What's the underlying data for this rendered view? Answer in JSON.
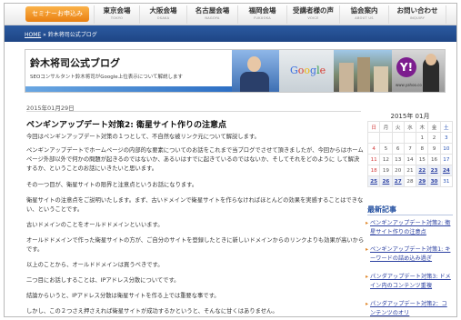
{
  "nav": {
    "seminar": "セミナーお申込み",
    "items": [
      {
        "label": "東京会場",
        "sub": "TOKYO"
      },
      {
        "label": "大阪会場",
        "sub": "OSAKA"
      },
      {
        "label": "名古屋会場",
        "sub": "NAGOYA"
      },
      {
        "label": "福岡会場",
        "sub": "FUKUOKA"
      },
      {
        "label": "受講者様の声",
        "sub": "VOICE"
      },
      {
        "label": "協会案内",
        "sub": "ABOUT US"
      },
      {
        "label": "お問い合わせ",
        "sub": "INQUIRY"
      }
    ]
  },
  "breadcrumb": {
    "home": "HOME",
    "sep": " » ",
    "current": "鈴木将司公式ブログ"
  },
  "banner": {
    "title": "鈴木将司公式ブログ",
    "subtitle": "SEOコンサルタント鈴木将司がGoogle上位表示について解説します",
    "google_logo": "Google",
    "yahoo_logo": "Y!",
    "yahoo_url": "www.yahoo.co"
  },
  "post": {
    "date": "2015年01月29日",
    "title": "ペンギンアップデート対策2: 衛星サイト作りの注意点",
    "paragraphs": [
      "今回はペンギンアップデート対策の１つとして、不自然な被リンク元について解説します。",
      "ペンギンアップデートでホームページの内部的な要素についてのお話をこれまで当ブログでさせて頂きましたが、今回からはホームページ外部以外で何かの問題が起きるのではないか、あるいはすでに起きているのではないか、そしてそれをどのように して解決するか、ということのお話にいきたいと思います。",
      "その一つ目が、衛星サイトの限界と注意点というお話になります。",
      "衛星サイトの注意点をご説明いたします。まず、古いドメインで衛星サイトを作らなければほとんどの効果を実感することはできない、ということです。",
      "古いドメインのことをオールドドメインといいます。",
      "オールドドメインで作った衛星サイトの方が、ご自分のサイトを登録したときに新しいドメインからのリンクよりも効果が高いからです。",
      "以上のことから、オールドドメインは買うべきです。",
      "二つ目にお話しすることは、IPアドレス分散についてです。",
      "結論からいうと、IPアドレス分散は衛星サイトを作る上では重要な事です。",
      "しかし、この２つさえ押さえれば衛星サイトが成功するかというと、そんなに甘くはありません。"
    ]
  },
  "calendar": {
    "title": "2015年 01月",
    "weekdays": [
      "日",
      "月",
      "火",
      "水",
      "木",
      "金",
      "土"
    ],
    "rows": [
      [
        "",
        "",
        "",
        "",
        "",
        "",
        ""
      ],
      [
        "",
        "",
        "",
        "",
        "1",
        "2",
        "3"
      ],
      [
        "4",
        "5",
        "6",
        "7",
        "8",
        "9",
        "10"
      ],
      [
        "11",
        "12",
        "13",
        "14",
        "15",
        "16",
        "17"
      ],
      [
        "18",
        "19",
        "20",
        "21",
        "22",
        "23",
        "24"
      ],
      [
        "25",
        "26",
        "27",
        "28",
        "29",
        "30",
        "31"
      ]
    ],
    "linked_days": [
      "22",
      "23",
      "24",
      "25",
      "26",
      "27",
      "29",
      "30"
    ]
  },
  "sidebar": {
    "heading": "最新記事",
    "links": [
      "ペンギンアップデート対策2: 衛星サイト作りの注意点",
      "ペンギンアップデート対策1: キーワードの詰め込み過ぎ",
      "パンダアップデート対策3: ドメイン内のコンテンツ重複",
      "パンダアップデート対策2：コンテンツのオリ"
    ]
  },
  "colors": {
    "nav_blue": "#1e4585",
    "accent_orange": "#e97f10",
    "link": "#2a3fa0"
  }
}
